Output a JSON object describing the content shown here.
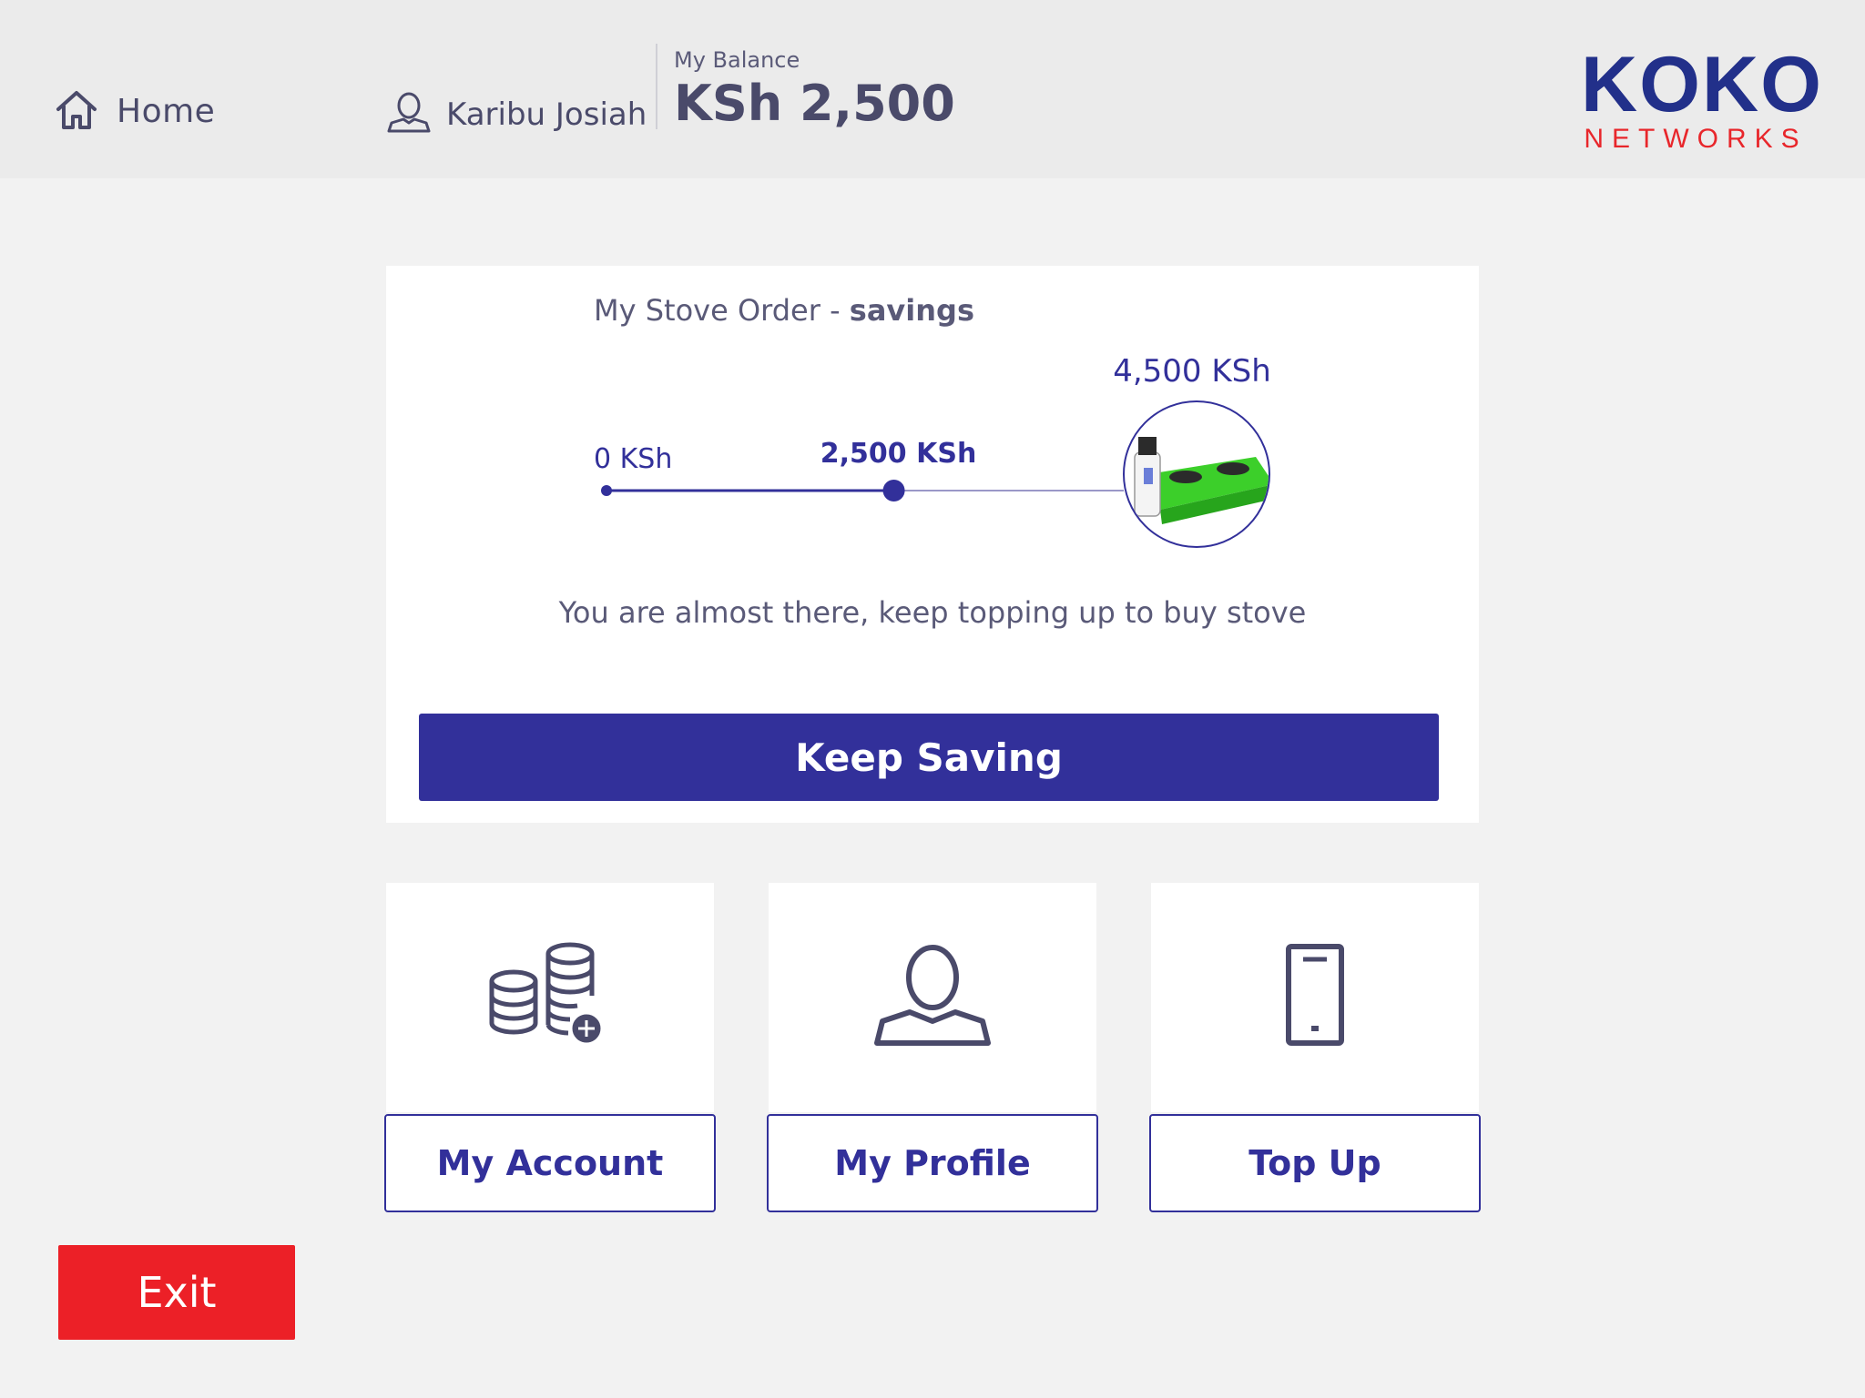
{
  "header": {
    "home_label": "Home",
    "user_label": "Karibu Josiah",
    "balance_caption": "My Balance",
    "balance_value": "KSh 2,500",
    "logo_main": "KOKO",
    "logo_sub": "NETWORKS"
  },
  "savings_card": {
    "title_prefix": "My Stove Order - ",
    "title_bold": "savings",
    "start_label": "0 KSh",
    "current_label": "2,500 KSh",
    "goal_label": "4,500 KSh",
    "current_amount": 2500,
    "goal_amount": 4500,
    "message": "You are almost there, keep topping up to buy stove",
    "button_label": "Keep Saving"
  },
  "tiles": [
    {
      "icon": "coins-plus-icon",
      "label": "My Account"
    },
    {
      "icon": "person-icon",
      "label": "My Profile"
    },
    {
      "icon": "phone-icon",
      "label": "Top Up"
    }
  ],
  "exit_label": "Exit",
  "colors": {
    "primary": "#32309a",
    "exit": "#ec2027",
    "logo_blue": "#22308a",
    "logo_red": "#e8262b",
    "text": "#4a4a6a",
    "stove_green": "#3ccf2a"
  }
}
